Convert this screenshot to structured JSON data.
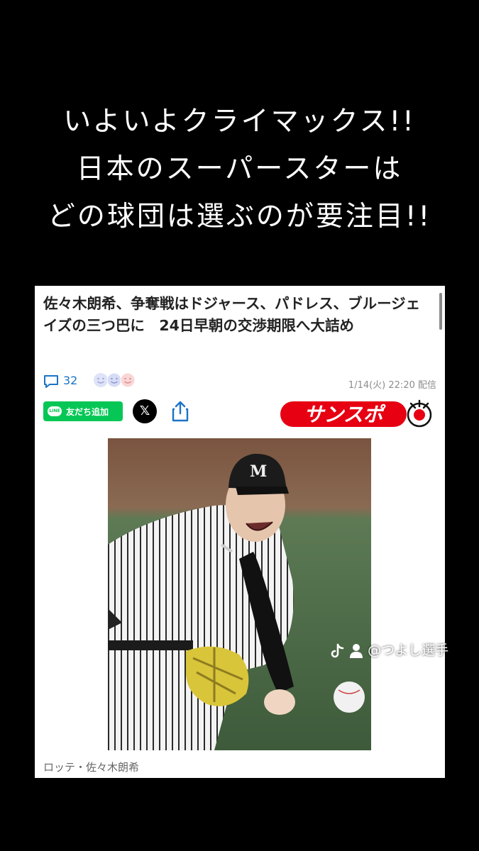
{
  "overlay_caption": {
    "lines": [
      "いよいよクライマックス!!",
      "日本のスーパースターは",
      "どの球団は選ぶのが要注目!!"
    ]
  },
  "article": {
    "headline": "佐々木朗希、争奪戦はドジャース、パドレス、ブルージェイズの三つ巴に　24日早朝の交渉期限へ大詰め",
    "comment_count": "32",
    "published": "1/14(火) 22:20 配信",
    "line_button_label": "友だち追加",
    "line_logo_text": "LINE",
    "x_button_label": "𝕏",
    "publisher_logo": "サンスポ",
    "photo_caption": "ロッテ・佐々木朗希",
    "photo_cap_letter": "M",
    "colors": {
      "headline": "#222222",
      "link_blue": "#1a73c8",
      "line_green": "#06c755",
      "sanspo_red": "#e60012"
    }
  },
  "watermark": {
    "handle": "@つよし選手",
    "icons": [
      "tiktok-icon",
      "person-icon"
    ]
  }
}
